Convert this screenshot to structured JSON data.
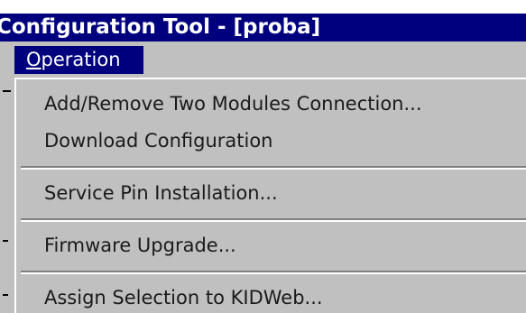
{
  "window": {
    "title": "Configuration Tool - [proba]"
  },
  "menubar": {
    "operation": {
      "label_underlined": "O",
      "label_rest": "peration"
    }
  },
  "menu": {
    "items": [
      {
        "label": "Add/Remove Two Modules Connection..."
      },
      {
        "label": "Download Configuration"
      },
      {
        "label": "Service Pin Installation..."
      },
      {
        "label": "Firmware Upgrade..."
      },
      {
        "label": "Assign Selection to KIDWeb..."
      }
    ]
  },
  "colors": {
    "titlebar": "#00007f",
    "menu_background": "#c0c0c0",
    "highlight": "#00007f",
    "text": "#1a1a1a"
  }
}
